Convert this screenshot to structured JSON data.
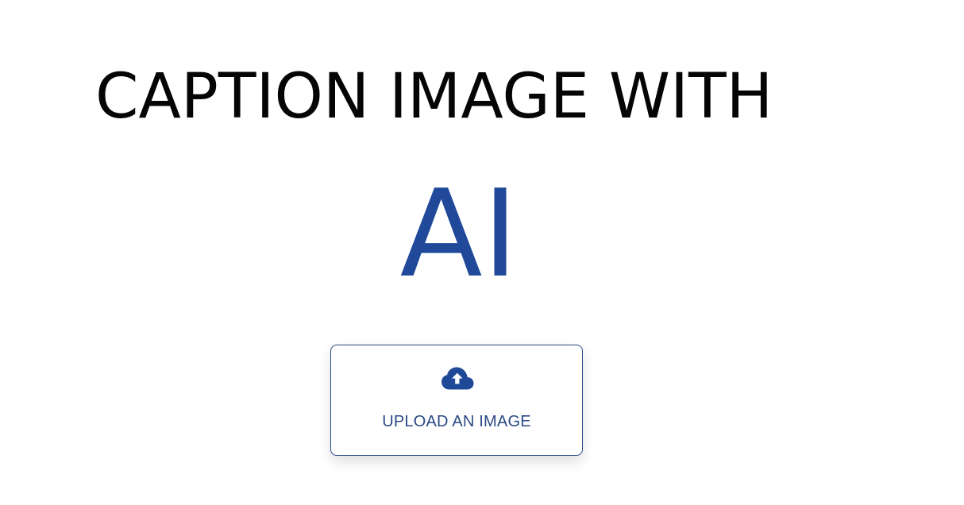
{
  "hero": {
    "title": "CAPTION IMAGE WITH",
    "accent": "AI",
    "title_color": "#050505",
    "accent_color": "#20499a"
  },
  "upload": {
    "label": "UPLOAD AN IMAGE",
    "icon": "cloud-upload-icon",
    "border_color": "#2a4a86",
    "text_color": "#2b4a86",
    "icon_color": "#1f4897"
  }
}
